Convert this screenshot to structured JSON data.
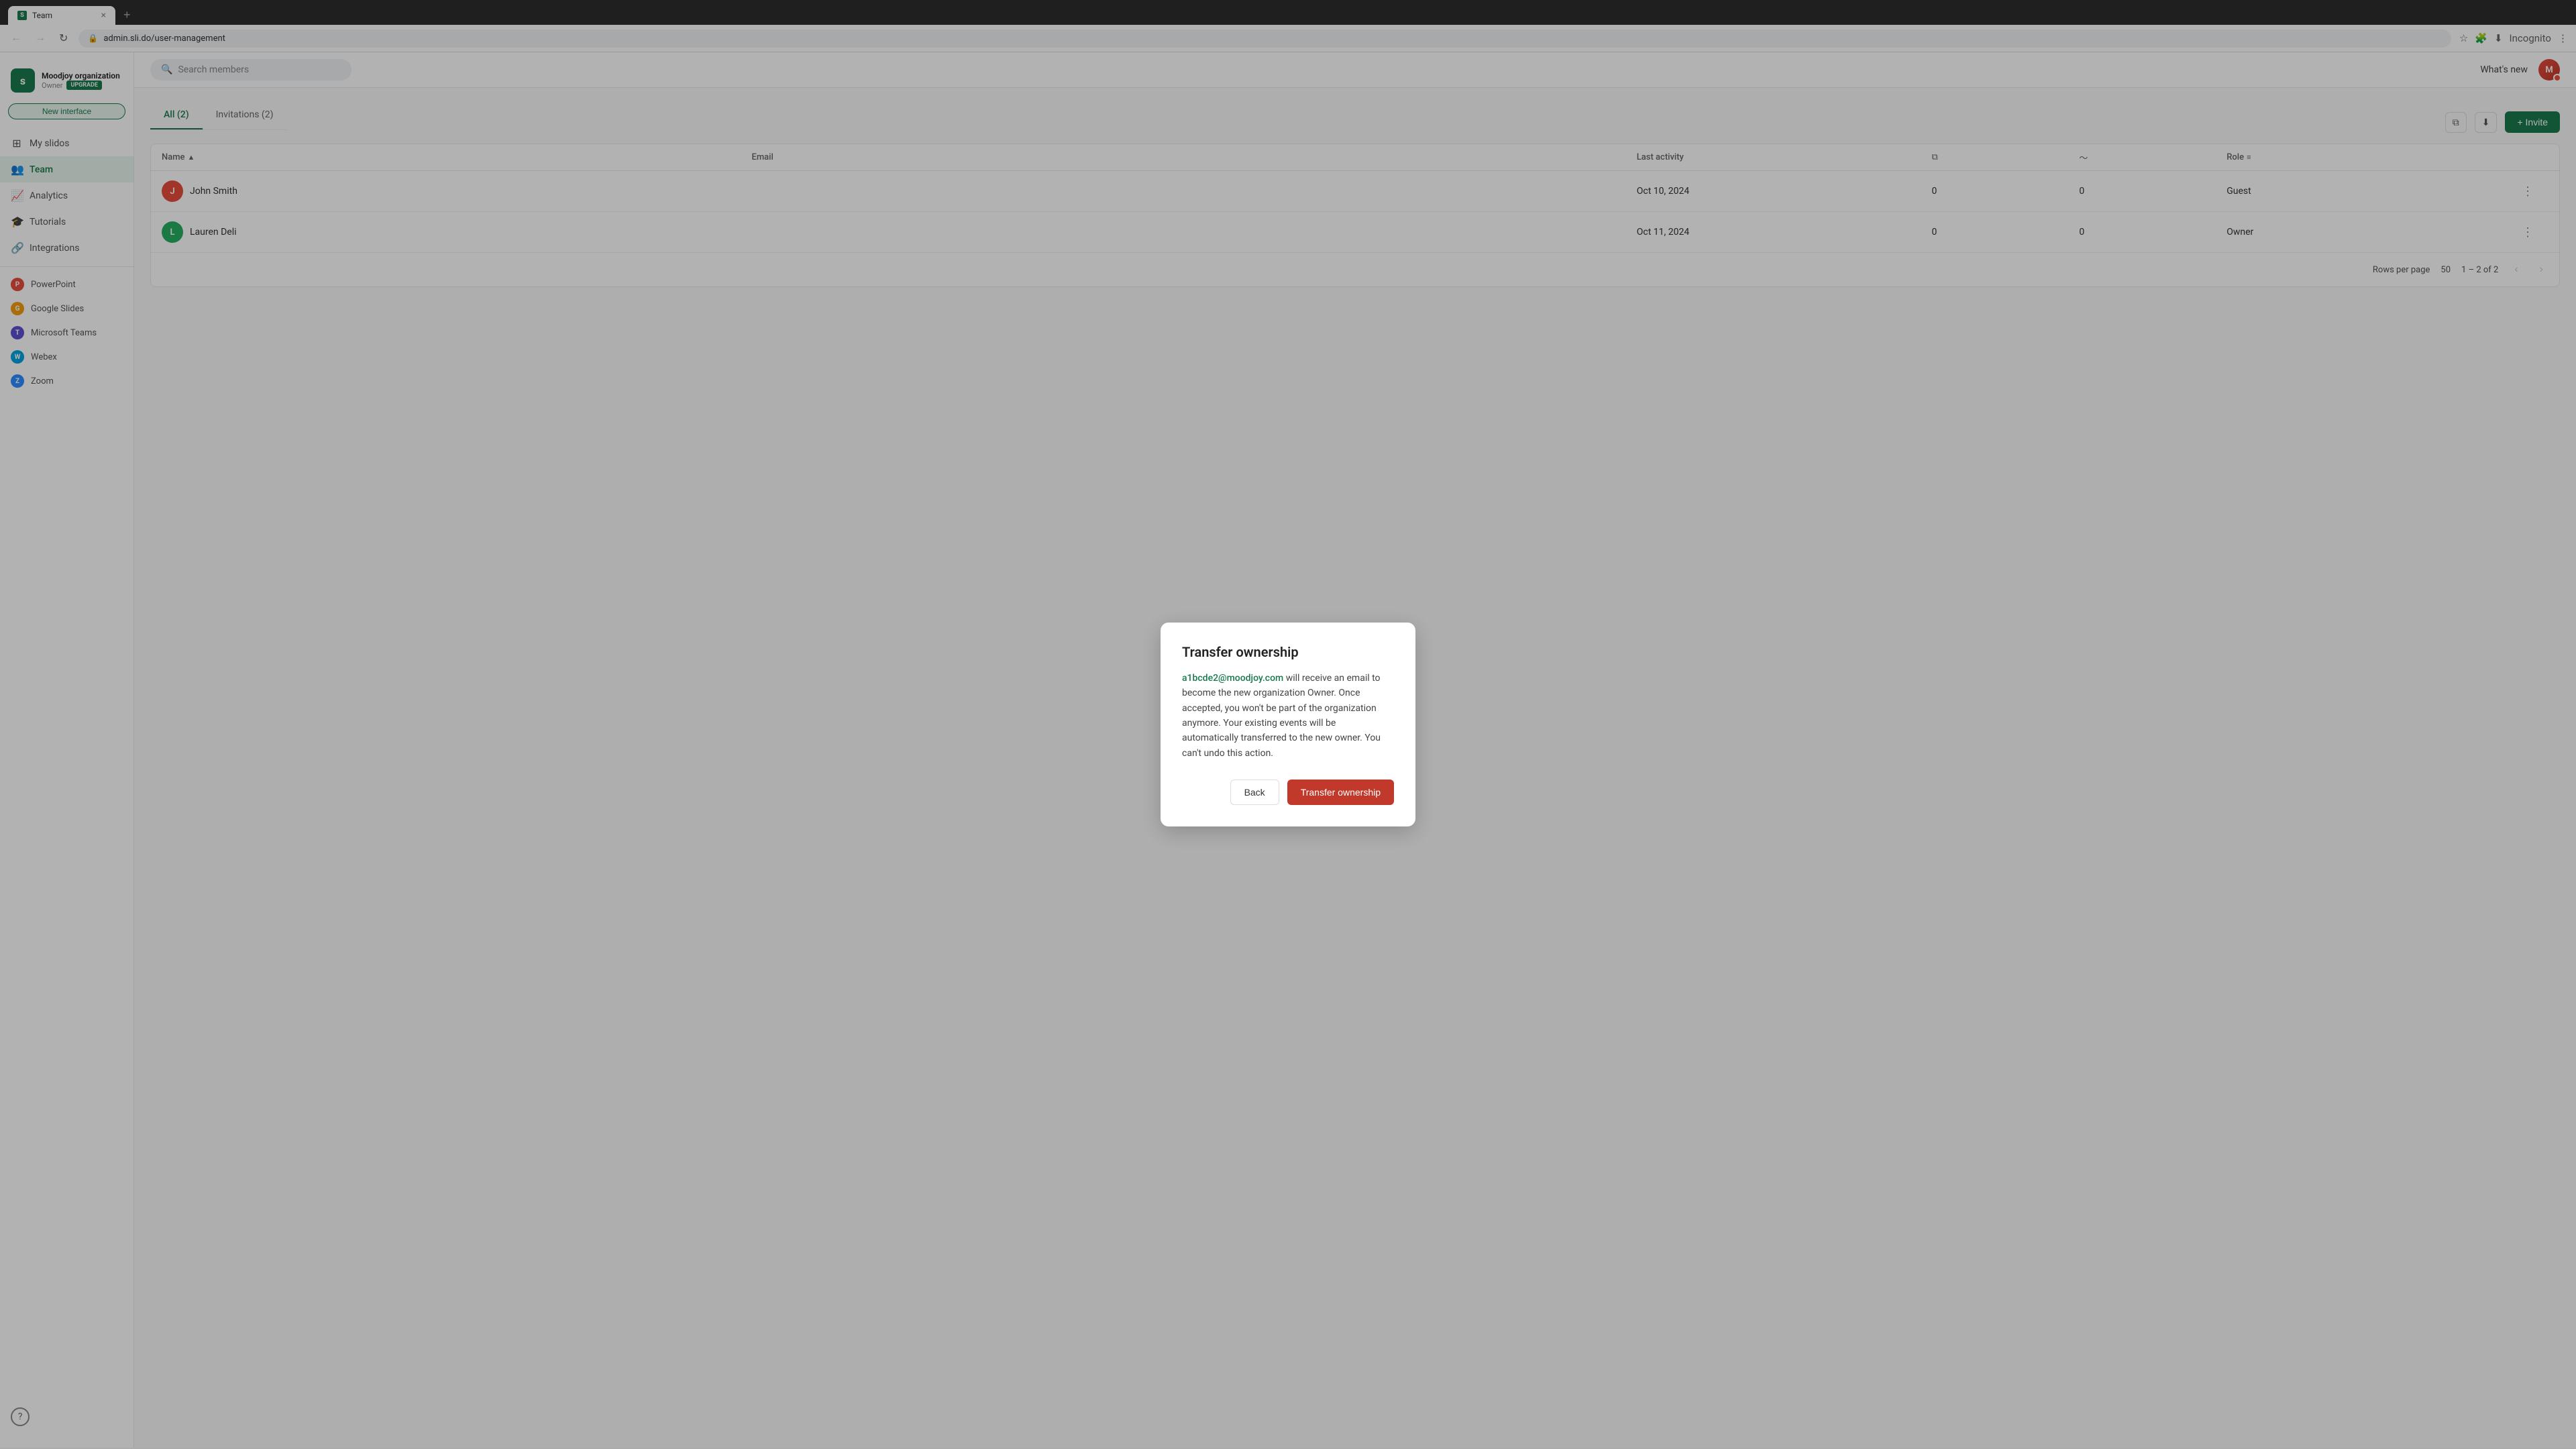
{
  "browser": {
    "tab_favicon": "S",
    "tab_title": "Team",
    "tab_close": "×",
    "tab_new": "+",
    "nav_back": "←",
    "nav_forward": "→",
    "nav_refresh": "↻",
    "address": "admin.sli.do/user-management",
    "address_icon": "🔒",
    "menu_icon": "⋮"
  },
  "header": {
    "logo_text": "slido",
    "org_name": "Moodjoy organization",
    "role": "Owner",
    "upgrade": "UPGRADE",
    "new_interface": "New interface",
    "search_placeholder": "Search members",
    "whats_new": "What's new",
    "avatar_initials": "M"
  },
  "sidebar": {
    "items": [
      {
        "id": "my-slidos",
        "label": "My slidos",
        "icon": "⊞",
        "active": false
      },
      {
        "id": "team",
        "label": "Team",
        "icon": "👥",
        "active": true
      },
      {
        "id": "analytics",
        "label": "Analytics",
        "icon": "📈",
        "active": false
      },
      {
        "id": "tutorials",
        "label": "Tutorials",
        "icon": "🎓",
        "active": false
      },
      {
        "id": "integrations",
        "label": "Integrations",
        "icon": "🔗",
        "active": false
      }
    ],
    "integrations": [
      {
        "id": "powerpoint",
        "label": "PowerPoint",
        "color": "#e74c3c",
        "initial": "P"
      },
      {
        "id": "google-slides",
        "label": "Google Slides",
        "color": "#f39c12",
        "initial": "G"
      },
      {
        "id": "ms-teams",
        "label": "Microsoft Teams",
        "color": "#5b4fcf",
        "initial": "T"
      },
      {
        "id": "webex",
        "label": "Webex",
        "color": "#00a1e0",
        "initial": "W"
      },
      {
        "id": "zoom",
        "label": "Zoom",
        "color": "#2d8cff",
        "initial": "Z"
      }
    ],
    "help": "?"
  },
  "page": {
    "tabs": [
      {
        "id": "all",
        "label": "All (2)",
        "active": true
      },
      {
        "id": "invitations",
        "label": "Invitations (2)",
        "active": false
      }
    ],
    "table": {
      "columns": [
        "Name",
        "Email",
        "Last activity",
        "",
        "",
        "Role",
        ""
      ],
      "sort_col": "Name",
      "rows": [
        {
          "initial": "J",
          "color": "#e74c3c",
          "name": "John Smith",
          "email": "",
          "last_activity": "Oct 10, 2024",
          "col1": "0",
          "col2": "0",
          "role": "Guest"
        },
        {
          "initial": "L",
          "color": "#27ae60",
          "name": "Lauren Deli",
          "email": "",
          "last_activity": "Oct 11, 2024",
          "col1": "0",
          "col2": "0",
          "role": "Owner"
        }
      ]
    },
    "pagination": {
      "rows_per_page_label": "Rows per page",
      "rows_per_page": "50",
      "range": "1 – 2 of 2"
    },
    "invite_btn": "+ Invite"
  },
  "dialog": {
    "title": "Transfer ownership",
    "email": "a1bcde2@moodjoy.com",
    "body_after_email": " will receive an email to become the new organization Owner. Once accepted, you won't be part of the organization anymore. Your existing events will be automatically transferred to the new owner. You can't undo this action.",
    "back_btn": "Back",
    "transfer_btn": "Transfer ownership"
  }
}
